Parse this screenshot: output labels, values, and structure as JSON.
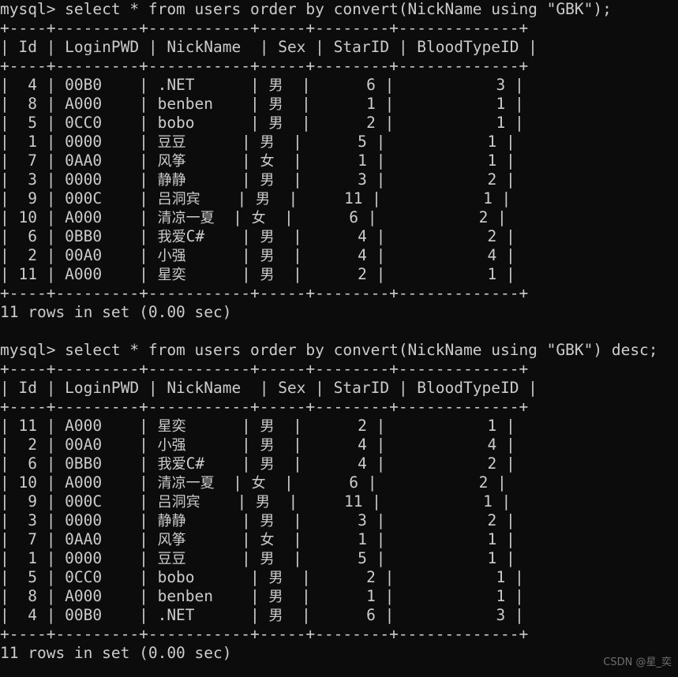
{
  "terminal": {
    "background_color": "#0c0c0c",
    "text_color": "#cccccc",
    "watermark": "CSDN @星_奕"
  },
  "columns": {
    "headers": [
      "Id",
      "LoginPWD",
      "NickName",
      "Sex",
      "StarID",
      "BloodTypeID"
    ],
    "widths": [
      4,
      9,
      11,
      5,
      8,
      13
    ],
    "separator": "+----+---------+-----------+-----+--------+-------------+",
    "header_row": "| Id | LoginPWD | NickName  | Sex | StarID | BloodTypeID |"
  },
  "blocks": [
    {
      "prompt": "mysql> select * from users order by convert(NickName using \"GBK\");",
      "status": "11 rows in set (0.00 sec)",
      "rows": [
        {
          "Id": "4",
          "LoginPWD": "00B0",
          "NickName": ".NET",
          "Sex": "男",
          "StarID": "6",
          "BloodTypeID": "3"
        },
        {
          "Id": "8",
          "LoginPWD": "A000",
          "NickName": "benben",
          "Sex": "男",
          "StarID": "1",
          "BloodTypeID": "1"
        },
        {
          "Id": "5",
          "LoginPWD": "0CC0",
          "NickName": "bobo",
          "Sex": "男",
          "StarID": "2",
          "BloodTypeID": "1"
        },
        {
          "Id": "1",
          "LoginPWD": "0000",
          "NickName": "豆豆",
          "Sex": "男",
          "StarID": "5",
          "BloodTypeID": "1"
        },
        {
          "Id": "7",
          "LoginPWD": "0AA0",
          "NickName": "风筝",
          "Sex": "女",
          "StarID": "1",
          "BloodTypeID": "1"
        },
        {
          "Id": "3",
          "LoginPWD": "0000",
          "NickName": "静静",
          "Sex": "男",
          "StarID": "3",
          "BloodTypeID": "2"
        },
        {
          "Id": "9",
          "LoginPWD": "000C",
          "NickName": "吕洞宾",
          "Sex": "男",
          "StarID": "11",
          "BloodTypeID": "1"
        },
        {
          "Id": "10",
          "LoginPWD": "A000",
          "NickName": "清凉一夏",
          "Sex": "女",
          "StarID": "6",
          "BloodTypeID": "2"
        },
        {
          "Id": "6",
          "LoginPWD": "0BB0",
          "NickName": "我爱C#",
          "Sex": "男",
          "StarID": "4",
          "BloodTypeID": "2"
        },
        {
          "Id": "2",
          "LoginPWD": "00A0",
          "NickName": "小强",
          "Sex": "男",
          "StarID": "4",
          "BloodTypeID": "4"
        },
        {
          "Id": "11",
          "LoginPWD": "A000",
          "NickName": "星奕",
          "Sex": "男",
          "StarID": "2",
          "BloodTypeID": "1"
        }
      ]
    },
    {
      "prompt": "mysql> select * from users order by convert(NickName using \"GBK\") desc;",
      "status": "11 rows in set (0.00 sec)",
      "rows": [
        {
          "Id": "11",
          "LoginPWD": "A000",
          "NickName": "星奕",
          "Sex": "男",
          "StarID": "2",
          "BloodTypeID": "1"
        },
        {
          "Id": "2",
          "LoginPWD": "00A0",
          "NickName": "小强",
          "Sex": "男",
          "StarID": "4",
          "BloodTypeID": "4"
        },
        {
          "Id": "6",
          "LoginPWD": "0BB0",
          "NickName": "我爱C#",
          "Sex": "男",
          "StarID": "4",
          "BloodTypeID": "2"
        },
        {
          "Id": "10",
          "LoginPWD": "A000",
          "NickName": "清凉一夏",
          "Sex": "女",
          "StarID": "6",
          "BloodTypeID": "2"
        },
        {
          "Id": "9",
          "LoginPWD": "000C",
          "NickName": "吕洞宾",
          "Sex": "男",
          "StarID": "11",
          "BloodTypeID": "1"
        },
        {
          "Id": "3",
          "LoginPWD": "0000",
          "NickName": "静静",
          "Sex": "男",
          "StarID": "3",
          "BloodTypeID": "2"
        },
        {
          "Id": "7",
          "LoginPWD": "0AA0",
          "NickName": "风筝",
          "Sex": "女",
          "StarID": "1",
          "BloodTypeID": "1"
        },
        {
          "Id": "1",
          "LoginPWD": "0000",
          "NickName": "豆豆",
          "Sex": "男",
          "StarID": "5",
          "BloodTypeID": "1"
        },
        {
          "Id": "5",
          "LoginPWD": "0CC0",
          "NickName": "bobo",
          "Sex": "男",
          "StarID": "2",
          "BloodTypeID": "1"
        },
        {
          "Id": "8",
          "LoginPWD": "A000",
          "NickName": "benben",
          "Sex": "男",
          "StarID": "1",
          "BloodTypeID": "1"
        },
        {
          "Id": "4",
          "LoginPWD": "00B0",
          "NickName": ".NET",
          "Sex": "男",
          "StarID": "6",
          "BloodTypeID": "3"
        }
      ]
    }
  ]
}
